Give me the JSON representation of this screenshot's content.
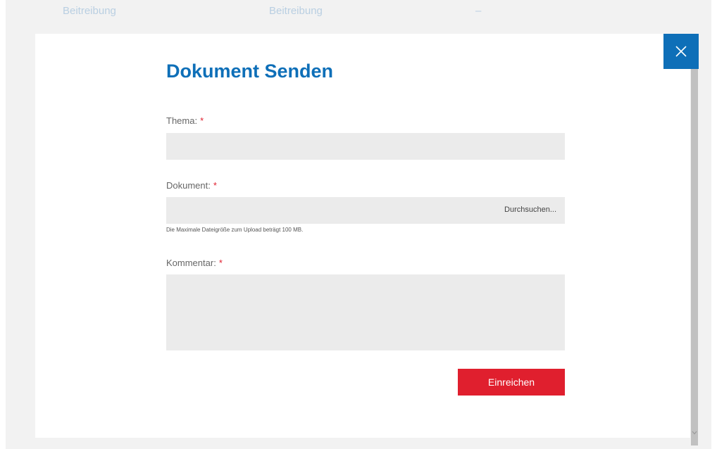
{
  "background": {
    "cells": [
      "Beitreibung",
      "Beitreibung",
      "–"
    ]
  },
  "modal": {
    "title": "Dokument Senden",
    "close_icon": "close-icon",
    "fields": {
      "thema": {
        "label": "Thema:",
        "required_marker": "*",
        "value": ""
      },
      "dokument": {
        "label": "Dokument:",
        "required_marker": "*",
        "browse_label": "Durchsuchen...",
        "hint": "Die Maximale Dateigröße zum Upload beträgt 100 MB."
      },
      "kommentar": {
        "label": "Kommentar:",
        "required_marker": "*",
        "value": ""
      }
    },
    "submit_label": "Einreichen"
  },
  "colors": {
    "accent_blue": "#0e6fb8",
    "submit_red": "#e01f2e",
    "field_gray": "#ebebeb"
  }
}
